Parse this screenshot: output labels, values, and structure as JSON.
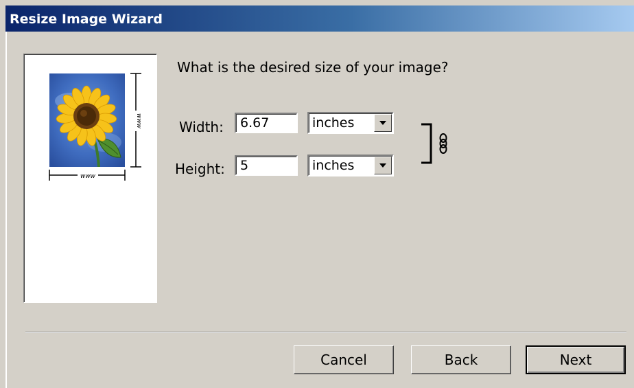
{
  "window": {
    "title": "Resize Image Wizard"
  },
  "preview": {
    "image_icon": "sunflower-photo",
    "width_marker": "www",
    "height_marker": "www"
  },
  "form": {
    "question": "What is the desired size of your image?",
    "width": {
      "label": "Width:",
      "value": "6.67",
      "unit": "inches"
    },
    "height": {
      "label": "Height:",
      "value": "5",
      "unit": "inches"
    },
    "link_icon": "chain-link-icon"
  },
  "buttons": {
    "cancel": "Cancel",
    "back": "Back",
    "next": "Next"
  },
  "colors": {
    "title_bar_start": "#0a246a",
    "title_bar_end": "#a6caf0",
    "dialog_background": "#d4d0c8"
  }
}
